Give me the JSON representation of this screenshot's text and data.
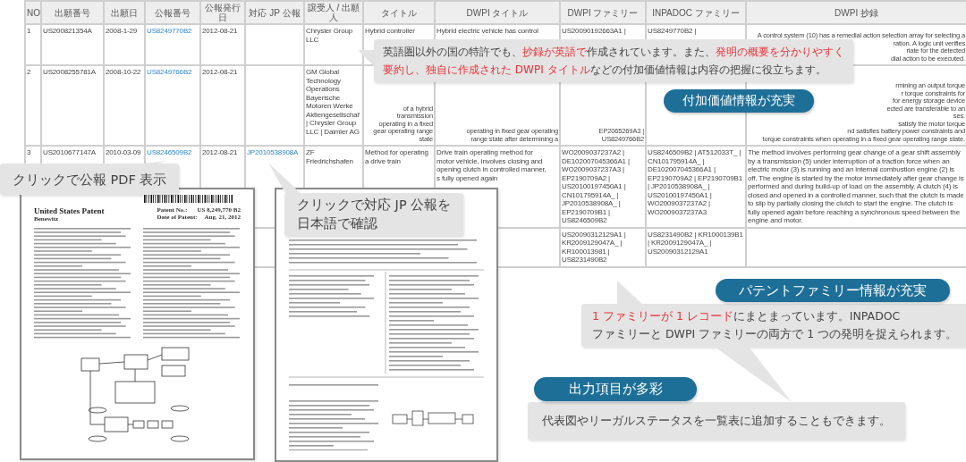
{
  "table": {
    "columns": [
      "NO",
      "出願番号",
      "出願日",
      "公報番号",
      "公報発行日",
      "対応 JP 公報",
      "譲受人 / 出願人",
      "タイトル",
      "DWPI タイトル",
      "DWPI ファミリー",
      "INPADOC ファミリー",
      "DWPI 抄録"
    ],
    "rows": [
      {
        "cells": [
          {
            "kind": "text",
            "text": "1"
          },
          {
            "kind": "text",
            "text": "US200821354A"
          },
          {
            "kind": "text",
            "text": "2008-1-29"
          },
          {
            "kind": "link",
            "text": "US8249770B2"
          },
          {
            "kind": "text",
            "text": "2012-08-21"
          },
          {
            "kind": "empty"
          },
          {
            "kind": "text",
            "text": "Chrysler Group LLC"
          },
          {
            "kind": "text",
            "text": "Hybrid controller"
          },
          {
            "kind": "text",
            "text": "Hybrid electric vehicle has control"
          },
          {
            "kind": "text",
            "text": "US20090192663A1 |"
          },
          {
            "kind": "text",
            "text": "US8249770B2 |"
          },
          {
            "kind": "fragments",
            "lines": [
              "A control system (10) has a remedial action selection array for selecting a",
              "ration. A logic unit verifies",
              "riate for the detected",
              "dial action to be executed."
            ]
          }
        ]
      },
      {
        "cells": [
          {
            "kind": "text",
            "text": "2"
          },
          {
            "kind": "text",
            "text": "US2008255781A"
          },
          {
            "kind": "text",
            "text": "2008-10-22"
          },
          {
            "kind": "link",
            "text": "US8249766B2"
          },
          {
            "kind": "text",
            "text": "2012-08-21"
          },
          {
            "kind": "empty"
          },
          {
            "kind": "lines",
            "lines": [
              "GM Global",
              "Technology",
              "Operations",
              "Bayerische",
              "Motoren Werke",
              "Aktiengesellschaf",
              "| Chrysler Group",
              "LLC | Daimler AG"
            ]
          },
          {
            "kind": "fragments",
            "lines": [
              "of a hybrid",
              "transmission",
              "operating in a fixed",
              "gear operating range",
              "state"
            ]
          },
          {
            "kind": "fragments",
            "lines": [
              "operating in fixed gear operating",
              "range state after determining a"
            ]
          },
          {
            "kind": "fragments",
            "lines": [
              "EP2065269A3 |",
              "US8249766B2"
            ]
          },
          {
            "kind": "empty"
          },
          {
            "kind": "fragments",
            "lines": [
              "rmining an output torque",
              "r torque constraints for",
              "for energy storage device",
              "ected are transferable to an",
              "ses.",
              "satisfy the motor torque",
              "nd satisfies battery power constraints and",
              "torque constraints when operating in a fixed gear operating range state."
            ]
          }
        ]
      },
      {
        "cells": [
          {
            "kind": "text",
            "text": "3"
          },
          {
            "kind": "text",
            "text": "US2010677147A"
          },
          {
            "kind": "text",
            "text": "2010-03-09"
          },
          {
            "kind": "link",
            "text": "US8246509B2"
          },
          {
            "kind": "text",
            "text": "2012-08-21"
          },
          {
            "kind": "link",
            "text": "JP2010538908A"
          },
          {
            "kind": "text",
            "text": "ZF Friedrichshafen"
          },
          {
            "kind": "text",
            "text": "Method for operating a drive train"
          },
          {
            "kind": "lines",
            "lines": [
              "Drive train operating method for",
              "motor vehicle, involves closing and",
              "opening clutch in controlled manner,",
              "s fully opened again"
            ]
          },
          {
            "kind": "text",
            "text": "WO2009037237A2 | DE102007045366A1 | WO2009037237A3 | EP2190709A2 | US20100197450A1 | CN101795914A_ | JP2010538908A_ | EP2190709B1 | US8246509B2"
          },
          {
            "kind": "text",
            "text": "US8246509B2 | AT512033T_ | CN101795914A_ | DE102007045366A1 | EP2190709A2 | EP2190709B1 | JP2010538908A_ | US20100197450A1 | WO2009037237A2 | WO2009037237A3"
          },
          {
            "kind": "text",
            "text": "The method involves performing gear change of a gear shift assembly by a transmission (5) under interruption of a traction force when an electric motor (3) is running and an internal combustion engine (2) is off. The engine is started by the motor immediately after gear change is performed and during build-up of load on the assembly. A clutch (4) is closed and opened in a controlled manner, such that the clutch is made to slip by partially closing the clutch to start the engine. The clutch is fully opened again before reaching a synchronous speed between the engine and motor."
          }
        ]
      },
      {
        "cells": [
          {
            "kind": "empty"
          },
          {
            "kind": "empty"
          },
          {
            "kind": "empty"
          },
          {
            "kind": "empty"
          },
          {
            "kind": "empty"
          },
          {
            "kind": "empty"
          },
          {
            "kind": "empty"
          },
          {
            "kind": "empty"
          },
          {
            "kind": "empty"
          },
          {
            "kind": "text",
            "text": "US20090312129A1 | KR2009129047A_ | KR100013981 | US8231490B2"
          },
          {
            "kind": "text",
            "text": "US8231490B2 | KR1000139B1 | KR2009129047A_ | US20090312129A1"
          },
          {
            "kind": "empty"
          }
        ]
      }
    ]
  },
  "documents": [
    {
      "kind": "us",
      "title": "United States Patent",
      "inventor": "Benewitz",
      "fields": [
        {
          "label": "Patent No.:",
          "value": "US 8,249,770 B2"
        },
        {
          "label": "Date of Patent:",
          "value": "Aug. 21, 2012"
        }
      ]
    },
    {
      "kind": "jp"
    }
  ],
  "callouts": [
    {
      "badge": "付加価値情報が充実",
      "lines": [
        [
          {
            "text": "英語圏以外の国の特許でも、",
            "highlight": false
          },
          {
            "text": "抄録が英語で",
            "highlight": true
          },
          {
            "text": "作成されています。また、",
            "highlight": false
          },
          {
            "text": "発明の概要を分かりやすく",
            "highlight": true
          }
        ],
        [
          {
            "text": "要約し、独自に作成された DWPI タイトル",
            "highlight": true
          },
          {
            "text": "などの付加価値情報は内容の把握に役立ちます。",
            "highlight": false
          }
        ]
      ]
    },
    {
      "lines": [
        [
          {
            "text": "クリックで公報 PDF 表示",
            "highlight": false
          }
        ]
      ]
    },
    {
      "lines": [
        [
          {
            "text": "クリックで対応 JP 公報を",
            "highlight": false
          }
        ],
        [
          {
            "text": "日本語で確認",
            "highlight": false
          }
        ]
      ]
    },
    {
      "badge": "パテントファミリー情報が充実",
      "lines": [
        [
          {
            "text": "1 ファミリーが 1 レコード",
            "highlight": true
          },
          {
            "text": "にまとまっています。INPADOC",
            "highlight": false
          }
        ],
        [
          {
            "text": "ファミリーと DWPI ファミリーの両方で 1 つの発明を捉えられます。",
            "highlight": false
          }
        ]
      ]
    },
    {
      "badge": "出力項目が多彩",
      "lines": [
        [
          {
            "text": "代表図やリーガルステータスを一覧表に追加することもできます。",
            "highlight": false
          }
        ]
      ]
    }
  ]
}
